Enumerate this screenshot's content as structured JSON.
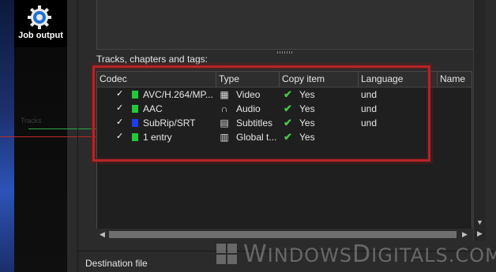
{
  "sidebar": {
    "job_label": "Job output",
    "icon": "gear-icon",
    "ghost_texts": [
      "",
      "Tracks"
    ]
  },
  "section": {
    "tracks_label": "Tracks, chapters and tags:",
    "destination_label": "Destination file"
  },
  "columns": [
    "Codec",
    "Type",
    "Copy item",
    "Language",
    "Name"
  ],
  "tracks": [
    {
      "codec": "AVC/H.264/MP...",
      "color": "#22c83a",
      "type": "Video",
      "type_icon": "video-icon",
      "copy": "Yes",
      "language": "und"
    },
    {
      "codec": "AAC",
      "color": "#22c83a",
      "type": "Audio",
      "type_icon": "headphones-icon",
      "copy": "Yes",
      "language": "und"
    },
    {
      "codec": "SubRip/SRT",
      "color": "#1e3df0",
      "type": "Subtitles",
      "type_icon": "subtitles-icon",
      "copy": "Yes",
      "language": "und"
    },
    {
      "codec": "1 entry",
      "color": "#22c83a",
      "type": "Global t...",
      "type_icon": "document-icon",
      "copy": "Yes",
      "language": ""
    }
  ],
  "watermark": {
    "text_w": "W",
    "text_rest": "INDOWS",
    "text_d": "D",
    "text_rest2": "IGITALS.COM"
  },
  "colors": {
    "highlight": "#b52428",
    "check_green": "#47c44a"
  }
}
